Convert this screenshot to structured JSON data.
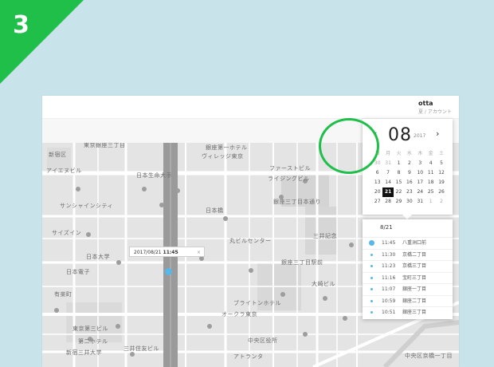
{
  "step": {
    "number": "3",
    "color": "#1fbf4a"
  },
  "user": {
    "name": "otta",
    "sub": "夏 / アカウント"
  },
  "map_labels": [
    {
      "text": "東京銀座三丁目"
    },
    {
      "text": "新宿区"
    },
    {
      "text": "銀座第一ホテル"
    },
    {
      "text": "ヴィレッジ東京"
    },
    {
      "text": "アイエヌビル"
    },
    {
      "text": "日本生命大手"
    },
    {
      "text": "ファーストビル"
    },
    {
      "text": "ライジングビル"
    },
    {
      "text": "銀座三丁目本通り"
    },
    {
      "text": "サンシャインシティ"
    },
    {
      "text": "日本橋"
    },
    {
      "text": "サイズイン"
    },
    {
      "text": "丸ビルセンター"
    },
    {
      "text": "日本大学"
    },
    {
      "text": "三井記念"
    },
    {
      "text": "銀座三丁目駅前"
    },
    {
      "text": "日本電子"
    },
    {
      "text": "大崎ビル"
    },
    {
      "text": "新宿三井大学"
    },
    {
      "text": "東京第三ビル"
    },
    {
      "text": "第二ホテル"
    },
    {
      "text": "ブライトンホテル"
    },
    {
      "text": "オークラ東京"
    },
    {
      "text": "アトランタ"
    },
    {
      "text": "三井住友ビル"
    },
    {
      "text": "中央区役所"
    },
    {
      "text": "有楽町"
    },
    {
      "text": "中央区京橋一丁目"
    }
  ],
  "popup": {
    "date": "2017/08/21",
    "time": "11:45",
    "close": "×"
  },
  "calendar": {
    "prev": "‹",
    "next": "›",
    "month": "08",
    "year": "2017",
    "weekdays": [
      "日",
      "月",
      "火",
      "水",
      "木",
      "金",
      "土"
    ],
    "weeks": [
      [
        "30",
        "31",
        "1",
        "2",
        "3",
        "4",
        "5"
      ],
      [
        "6",
        "7",
        "8",
        "9",
        "10",
        "11",
        "12"
      ],
      [
        "13",
        "14",
        "15",
        "16",
        "17",
        "18",
        "19"
      ],
      [
        "20",
        "21",
        "22",
        "23",
        "24",
        "25",
        "26"
      ],
      [
        "27",
        "28",
        "29",
        "30",
        "31",
        "1",
        "2"
      ]
    ],
    "selected": "21"
  },
  "history": {
    "date": "8/21",
    "items": [
      {
        "time": "11:45",
        "place": "八重洲口前"
      },
      {
        "time": "11:30",
        "place": "京橋二丁目"
      },
      {
        "time": "11:23",
        "place": "京橋三丁目"
      },
      {
        "time": "11:16",
        "place": "宝町三丁目"
      },
      {
        "time": "11:07",
        "place": "銀座一丁目"
      },
      {
        "time": "10:59",
        "place": "銀座二丁目"
      },
      {
        "time": "10:51",
        "place": "銀座三丁目"
      }
    ]
  }
}
